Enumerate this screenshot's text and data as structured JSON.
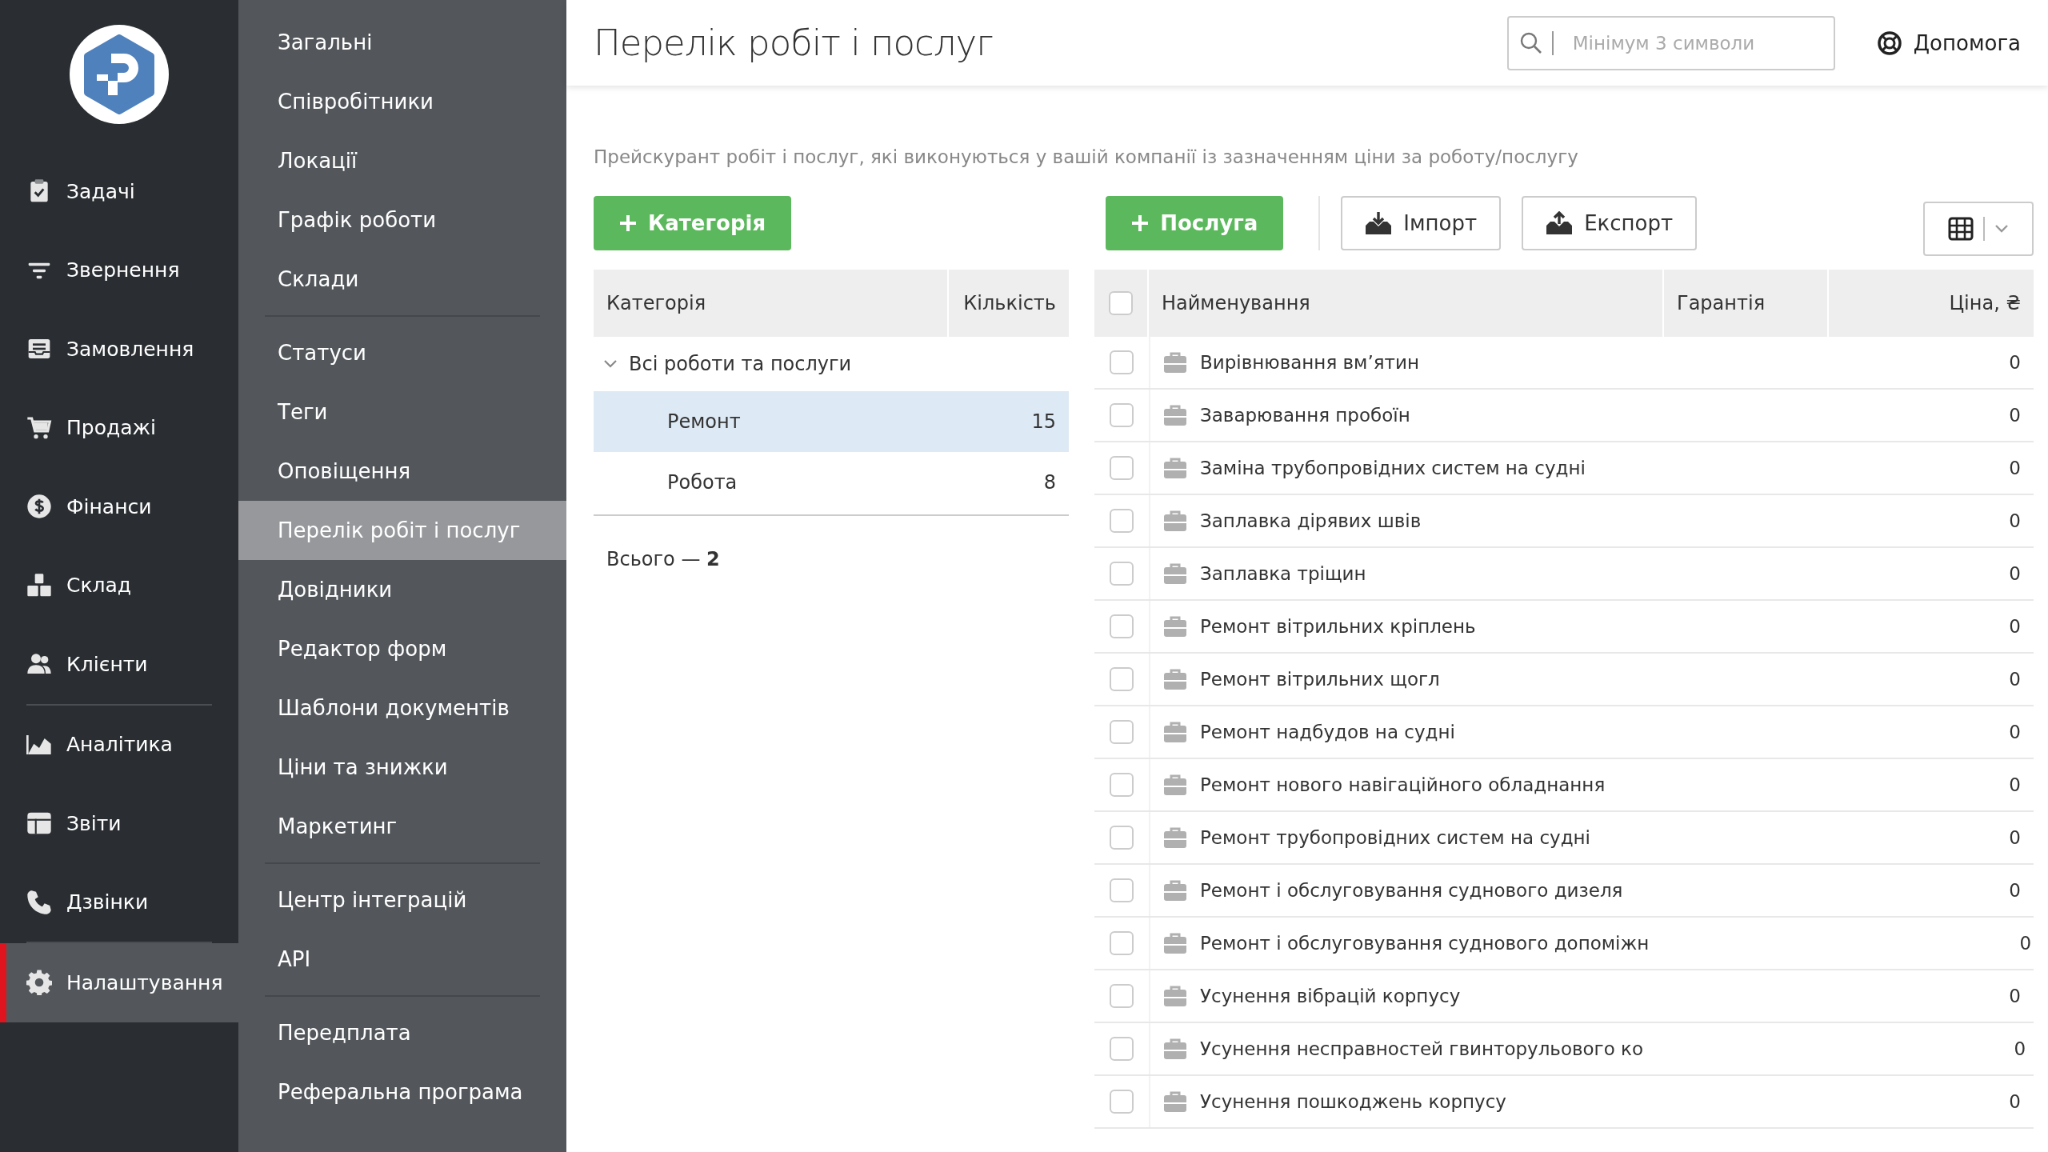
{
  "nav": {
    "groups": [
      {
        "items": [
          {
            "label": "Задачі",
            "selected": false
          },
          {
            "label": "Звернення",
            "selected": false
          },
          {
            "label": "Замовлення",
            "selected": false
          },
          {
            "label": "Продажі",
            "selected": false
          },
          {
            "label": "Фінанси",
            "selected": false
          },
          {
            "label": "Склад",
            "selected": false
          },
          {
            "label": "Клієнти",
            "selected": false
          }
        ]
      },
      {
        "items": [
          {
            "label": "Аналітика",
            "selected": false
          },
          {
            "label": "Звіти",
            "selected": false
          },
          {
            "label": "Дзвінки",
            "selected": false
          }
        ]
      },
      {
        "items": [
          {
            "label": "Налаштування",
            "selected": true
          }
        ]
      }
    ]
  },
  "submenu": {
    "groups": [
      {
        "items": [
          {
            "label": "Загальні",
            "selected": false
          },
          {
            "label": "Співробітники",
            "selected": false
          },
          {
            "label": "Локації",
            "selected": false
          },
          {
            "label": "Графік роботи",
            "selected": false
          },
          {
            "label": "Склади",
            "selected": false
          }
        ]
      },
      {
        "items": [
          {
            "label": "Статуси",
            "selected": false
          },
          {
            "label": "Теги",
            "selected": false
          },
          {
            "label": "Оповіщення",
            "selected": false
          },
          {
            "label": "Перелік робіт і послуг",
            "selected": true
          },
          {
            "label": "Довідники",
            "selected": false
          },
          {
            "label": "Редактор форм",
            "selected": false
          },
          {
            "label": "Шаблони документів",
            "selected": false
          },
          {
            "label": "Ціни та знижки",
            "selected": false
          },
          {
            "label": "Маркетинг",
            "selected": false
          }
        ]
      },
      {
        "items": [
          {
            "label": "Центр інтеграцій",
            "selected": false
          },
          {
            "label": "API",
            "selected": false
          }
        ]
      },
      {
        "items": [
          {
            "label": "Передплата",
            "selected": false
          },
          {
            "label": "Реферальна програма",
            "selected": false
          }
        ]
      }
    ]
  },
  "header": {
    "title": "Перелік робіт і послуг",
    "search": {
      "placeholder": "Мінімум 3 символи"
    },
    "help": "Допомога"
  },
  "description": "Прейскурант робіт і послуг, які виконуються у вашій компанії із зазначенням ціни за роботу/послугу",
  "toolbar": {
    "add_category": "Категорія",
    "add_service": "Послуга",
    "import": "Імпорт",
    "export": "Експорт"
  },
  "categories": {
    "columns": [
      "Категорія",
      "Кількість"
    ],
    "root": {
      "label": "Всі роботи та послуги",
      "expanded": true,
      "children": [
        {
          "label": "Ремонт",
          "count": "15",
          "selected": true
        },
        {
          "label": "Робота",
          "count": "8",
          "selected": false
        }
      ]
    },
    "total": "Всього — **2**"
  },
  "services": {
    "columns": [
      "Найменування",
      "Гарантія",
      "Ціна, ₴"
    ],
    "all_checked": false,
    "rows": [
      {
        "name": "Вирівнювання вм’ятин",
        "price": "0",
        "checked": false
      },
      {
        "name": "Заварювання пробоїн",
        "price": "0",
        "checked": false
      },
      {
        "name": "Заміна трубопровідних систем на судні",
        "price": "0",
        "checked": false
      },
      {
        "name": "Заплавка дірявих швів",
        "price": "0",
        "checked": false
      },
      {
        "name": "Заплавка тріщин",
        "price": "0",
        "checked": false
      },
      {
        "name": "Ремонт вітрильних кріплень",
        "price": "0",
        "checked": false
      },
      {
        "name": "Ремонт вітрильних щогл",
        "price": "0",
        "checked": false
      },
      {
        "name": "Ремонт надбудов на судні",
        "price": "0",
        "checked": false
      },
      {
        "name": "Ремонт нового навігаційного обладнання",
        "price": "0",
        "checked": false
      },
      {
        "name": "Ремонт трубопровідних систем на судні",
        "price": "0",
        "checked": false
      },
      {
        "name": "Ремонт і обслуговування суднового дизеля",
        "price": "0",
        "checked": false
      },
      {
        "name": "Ремонт і обслуговування суднового допоміжн",
        "price": "0",
        "checked": false
      },
      {
        "name": "Усунення вібрацій корпусу",
        "price": "0",
        "checked": false
      },
      {
        "name": "Усунення несправностей гвинторульового ко",
        "price": "0",
        "checked": false
      },
      {
        "name": "Усунення пошкоджень корпусу",
        "price": "0",
        "checked": false
      }
    ]
  }
}
